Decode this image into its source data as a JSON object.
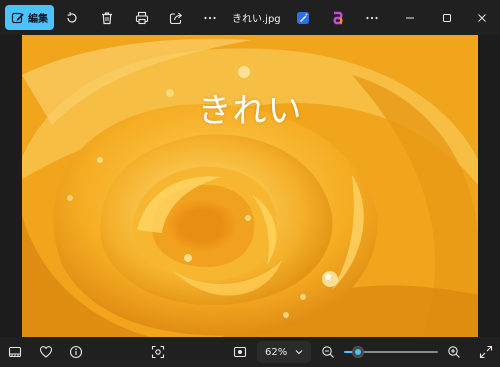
{
  "toolbar": {
    "edit_label": "編集",
    "filename": "きれい.jpg",
    "icons": [
      "edit-icon",
      "rotate-icon",
      "delete-icon",
      "print-icon",
      "share-icon",
      "more-icon",
      "designer-icon",
      "clipchamp-icon",
      "more-icon"
    ],
    "window_controls": [
      "minimize-icon",
      "maximize-icon",
      "close-icon"
    ]
  },
  "image": {
    "caption": "きれい"
  },
  "bottombar": {
    "zoom_label": "62%",
    "zoom_level": 0.15,
    "icons": [
      "filmstrip-icon",
      "favorite-icon",
      "info-icon",
      "select-region-icon",
      "fit-window-icon",
      "zoom-out-icon",
      "zoom-in-icon",
      "fullscreen-icon"
    ]
  },
  "colors": {
    "accent": "#4cc2ff",
    "chrome": "#202020",
    "background": "#1c1c1c"
  }
}
